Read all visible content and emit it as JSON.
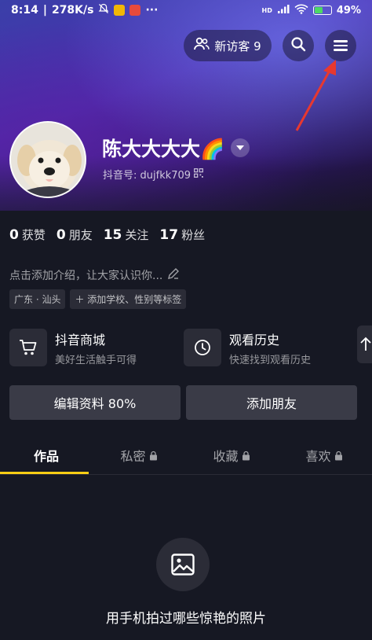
{
  "status_bar": {
    "time": "8:14",
    "network_speed": "278K/s",
    "signal_label": "HD",
    "battery": "49%",
    "battery_level": 0.49
  },
  "header": {
    "visitor_label": "新访客 9",
    "search_icon": "search-icon",
    "menu_icon": "menu-icon"
  },
  "profile": {
    "name": "陈大大大大🌈",
    "douyin_id": "抖音号: dujfkk709"
  },
  "stats": [
    {
      "num": "0",
      "label": "获赞"
    },
    {
      "num": "0",
      "label": "朋友"
    },
    {
      "num": "15",
      "label": "关注"
    },
    {
      "num": "17",
      "label": "粉丝"
    }
  ],
  "bio": {
    "placeholder": "点击添加介绍，让大家认识你..."
  },
  "tags": [
    {
      "label": "广东 · 汕头"
    },
    {
      "label": "＋ 添加学校、性别等标签"
    }
  ],
  "shortcuts": [
    {
      "title": "抖音商城",
      "subtitle": "美好生活触手可得",
      "icon": "cart-icon"
    },
    {
      "title": "观看历史",
      "subtitle": "快速找到观看历史",
      "icon": "clock-icon"
    }
  ],
  "actions": {
    "edit_profile": "编辑资料 80%",
    "add_friend": "添加朋友"
  },
  "tabs": [
    {
      "label": "作品",
      "locked": false
    },
    {
      "label": "私密",
      "locked": true
    },
    {
      "label": "收藏",
      "locked": true
    },
    {
      "label": "喜欢",
      "locked": true
    }
  ],
  "empty_state": {
    "text": "用手机拍过哪些惊艳的照片",
    "icon": "image-icon"
  },
  "colors": {
    "background": "#161823",
    "tab_accent": "#face15",
    "annotation_arrow": "#e8382f"
  }
}
